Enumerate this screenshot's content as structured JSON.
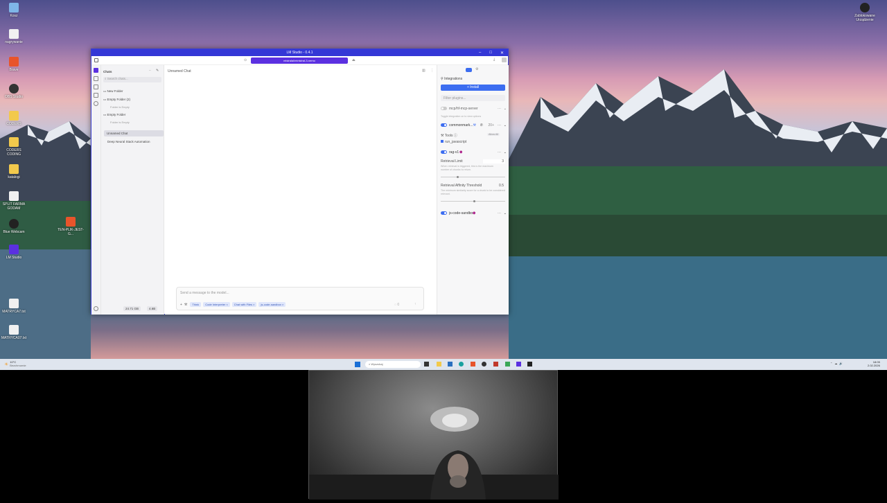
{
  "desktop": {
    "icons_left": [
      {
        "label": "Kosz",
        "color": "#7fb6e8"
      },
      {
        "label": "nagrywanie",
        "color": "#f1f1f1"
      },
      {
        "label": "Brave",
        "color": "#e8542b"
      },
      {
        "label": "OBS Studio",
        "color": "#333333"
      },
      {
        "label": "CODERS",
        "color": "#f2c94c"
      },
      {
        "label": "CODERS CODING",
        "color": "#f2c94c"
      },
      {
        "label": "katalogi",
        "color": "#f2c94c"
      },
      {
        "label": "SPLIT FARMA GODAM",
        "color": "#f1f1f1"
      },
      {
        "label": "Blue Webcam",
        "color": "#222222"
      },
      {
        "label": "LM Studio",
        "color": "#5b30e0"
      },
      {
        "label": "MATRYCA7.txt",
        "color": "#f1f1f1"
      },
      {
        "label": "MATRYCA07.txt",
        "color": "#f1f1f1"
      }
    ],
    "icon_mid": {
      "label": "TEN-PLIK-JEST-G...",
      "color": "#e8542b"
    },
    "icon_topright": {
      "label": "Zablokowane Urządzenie"
    }
  },
  "window": {
    "title": "LM Studio - 0.4.1",
    "model_selector": "mistralai/ministral-3-nemo",
    "sidebar": {
      "chats_label": "Chats",
      "search_placeholder": "Search chats...",
      "new_folder": "New Folder",
      "folders": [
        {
          "name": "Empty Folder (2)",
          "empty_text": "Folder is Empty"
        },
        {
          "name": "Empty Folder",
          "empty_text": "Folder is Empty"
        }
      ],
      "chats": [
        "Unnamed Chat",
        "Deep Neural Stack Automation"
      ],
      "footer_left": "24.71 GB",
      "footer_right": "4.6B"
    },
    "main": {
      "chat_title": "Unnamed Chat",
      "input_placeholder": "Send a message to the model...",
      "chips": [
        "Think",
        "Code Interpreter",
        "Chat with Files",
        "js-code-sandbox"
      ],
      "token_count": "0"
    },
    "right_panel": {
      "integrations_label": "Integrations",
      "install_label": "Install",
      "filter_placeholder": "Filter plugins...",
      "plugins": [
        {
          "name": "mcp/hf-mcp-server",
          "enabled": false,
          "desc": "Toggle integration on to view options"
        },
        {
          "name": "commonmark...",
          "enabled": true,
          "badge": "20+"
        }
      ],
      "tools_label": "Tools",
      "tools_btn": "Allow All",
      "tool_item": "run_javascript",
      "rag_plugin": "rag-v1",
      "retrieval_limit_label": "Retrieval Limit",
      "retrieval_limit_value": "3",
      "retrieval_limit_desc": "When retrieval is triggered, this is the maximum number of chunks to return.",
      "retrieval_limit_slider": 0.25,
      "affinity_label": "Retrieval Affinity Threshold",
      "affinity_value": "0.5",
      "affinity_desc": "The minimum similarity score for a chunk to be considered relevant.",
      "affinity_slider": 0.5,
      "sandbox_plugin": "js-code-sandbox"
    }
  },
  "taskbar": {
    "weather_temp": "10°C",
    "weather_desc": "Bezchmurnie",
    "search_placeholder": "Wyszukaj",
    "time": "18:05",
    "date": "2.02.2026"
  }
}
